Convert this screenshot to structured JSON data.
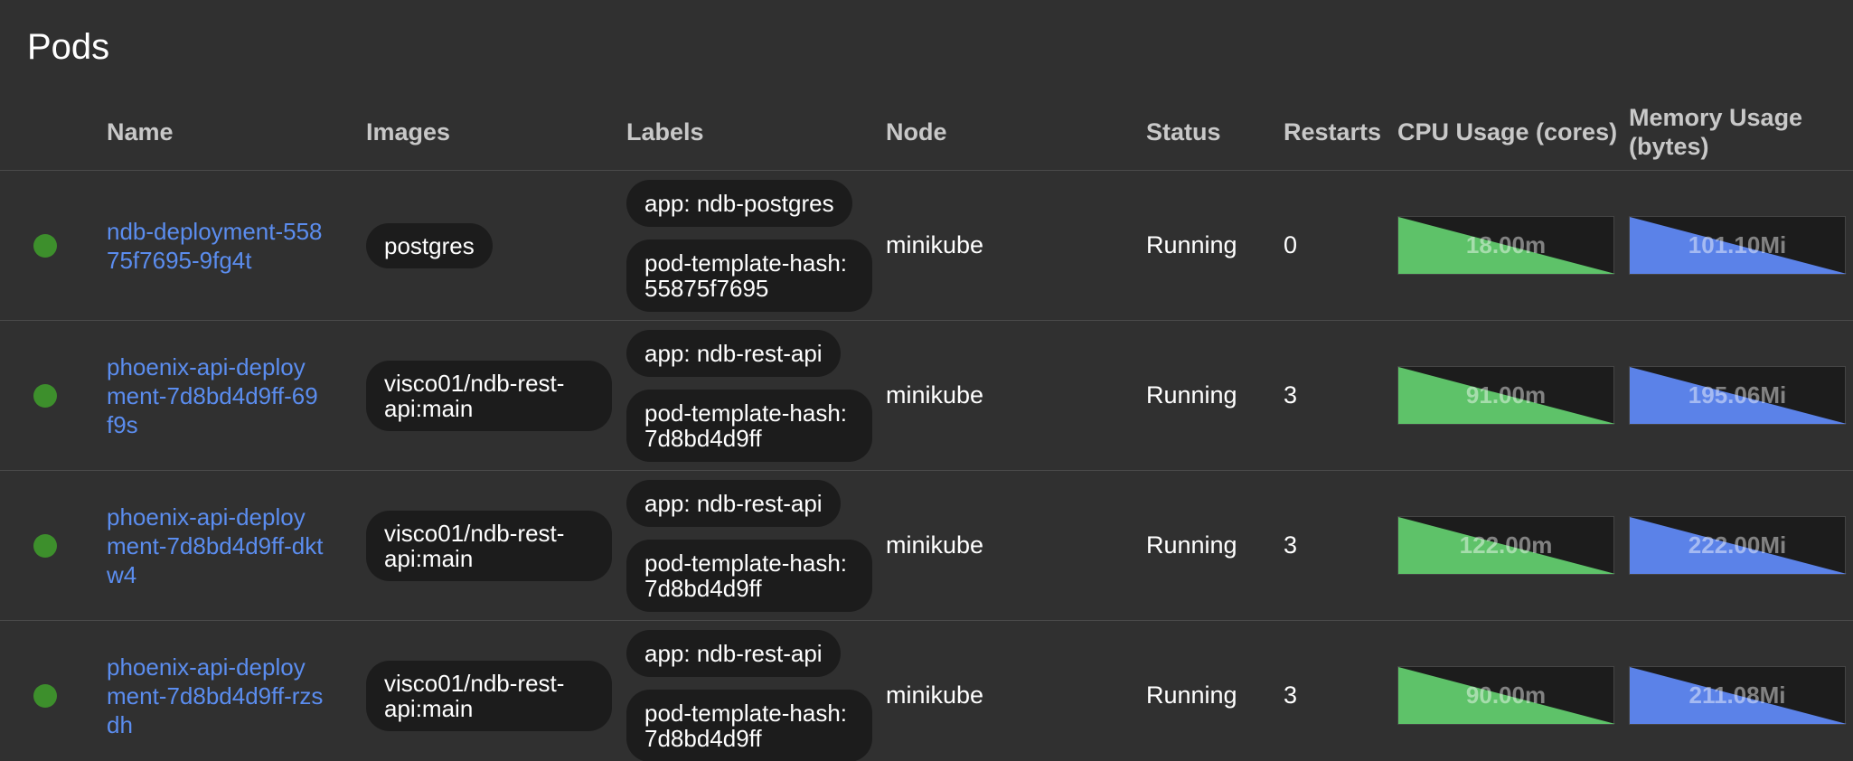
{
  "page": {
    "title": "Pods"
  },
  "columns": {
    "name": "Name",
    "images": "Images",
    "labels": "Labels",
    "node": "Node",
    "status": "Status",
    "restarts": "Restarts",
    "cpu": "CPU Usage (cores)",
    "memory_line1": "Memory Usage",
    "memory_line2": "(bytes)"
  },
  "colors": {
    "status_ok": "#3d8f2c",
    "link": "#5b8def",
    "cpu_fill": "#5ec269",
    "memory_fill": "#5b82e8"
  },
  "rows": [
    {
      "name": "ndb-deployment-55875f7695-9fg4t",
      "image": "postgres",
      "labels": [
        "app: ndb-postgres",
        "pod-template-hash: 55875f7695"
      ],
      "node": "minikube",
      "status": "Running",
      "restarts": "0",
      "cpu": "18.00m",
      "memory": "101.10Mi"
    },
    {
      "name": "phoenix-api-deployment-7d8bd4d9ff-69f9s",
      "image": "visco01/ndb-rest-api:main",
      "labels": [
        "app: ndb-rest-api",
        "pod-template-hash: 7d8bd4d9ff"
      ],
      "node": "minikube",
      "status": "Running",
      "restarts": "3",
      "cpu": "91.00m",
      "memory": "195.06Mi"
    },
    {
      "name": "phoenix-api-deployment-7d8bd4d9ff-dktw4",
      "image": "visco01/ndb-rest-api:main",
      "labels": [
        "app: ndb-rest-api",
        "pod-template-hash: 7d8bd4d9ff"
      ],
      "node": "minikube",
      "status": "Running",
      "restarts": "3",
      "cpu": "122.00m",
      "memory": "222.00Mi"
    },
    {
      "name": "phoenix-api-deployment-7d8bd4d9ff-rzsdh",
      "image": "visco01/ndb-rest-api:main",
      "labels": [
        "app: ndb-rest-api",
        "pod-template-hash: 7d8bd4d9ff"
      ],
      "node": "minikube",
      "status": "Running",
      "restarts": "3",
      "cpu": "90.00m",
      "memory": "211.08Mi"
    }
  ]
}
